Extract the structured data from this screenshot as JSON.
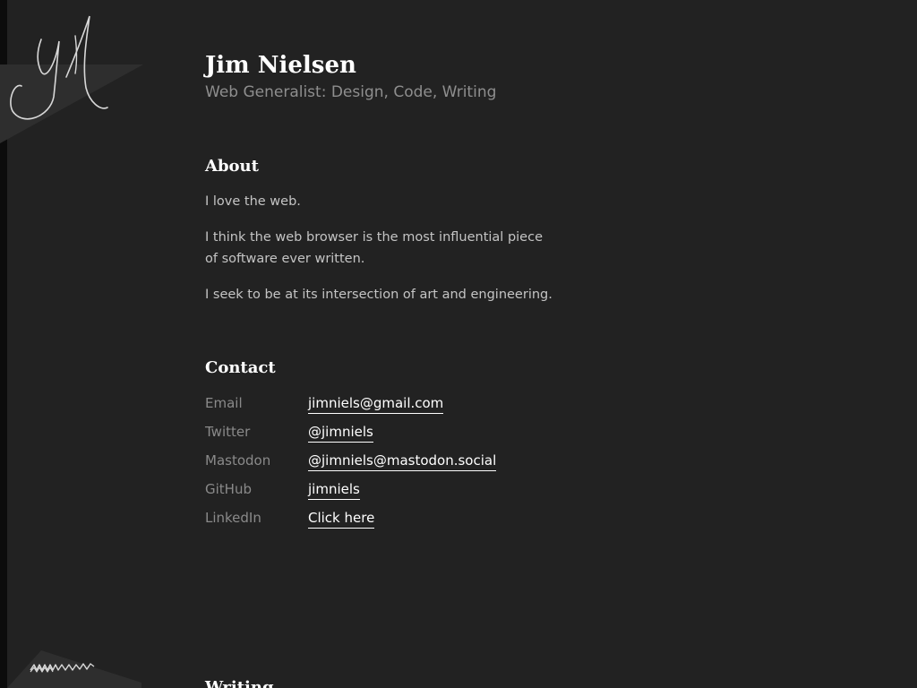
{
  "site": {
    "title": "Jim Nielsen",
    "tagline": "Web Generalist: Design, Code, Writing"
  },
  "about": {
    "heading": "About",
    "paragraphs": [
      "I love the web.",
      "I think the web browser is the most influential piece of software ever written.",
      "I seek to be at its intersection of art and engineering."
    ]
  },
  "contact": {
    "heading": "Contact",
    "items": [
      {
        "label": "Email",
        "value": "jimniels@gmail.com"
      },
      {
        "label": "Twitter",
        "value": "@jimniels"
      },
      {
        "label": "Mastodon",
        "value": "@jimniels@mastodon.social"
      },
      {
        "label": "GitHub",
        "value": "jimniels"
      },
      {
        "label": "LinkedIn",
        "value": "Click here"
      }
    ]
  },
  "writing": {
    "heading": "Writing"
  },
  "colors": {
    "background": "#222222",
    "heading": "#ffffff",
    "text": "#c4c4c4",
    "muted": "#8e8e8e",
    "link": "#ffffff"
  },
  "icons": {
    "logo": "jn-signature-logo",
    "decoration": "scribble-decoration"
  }
}
